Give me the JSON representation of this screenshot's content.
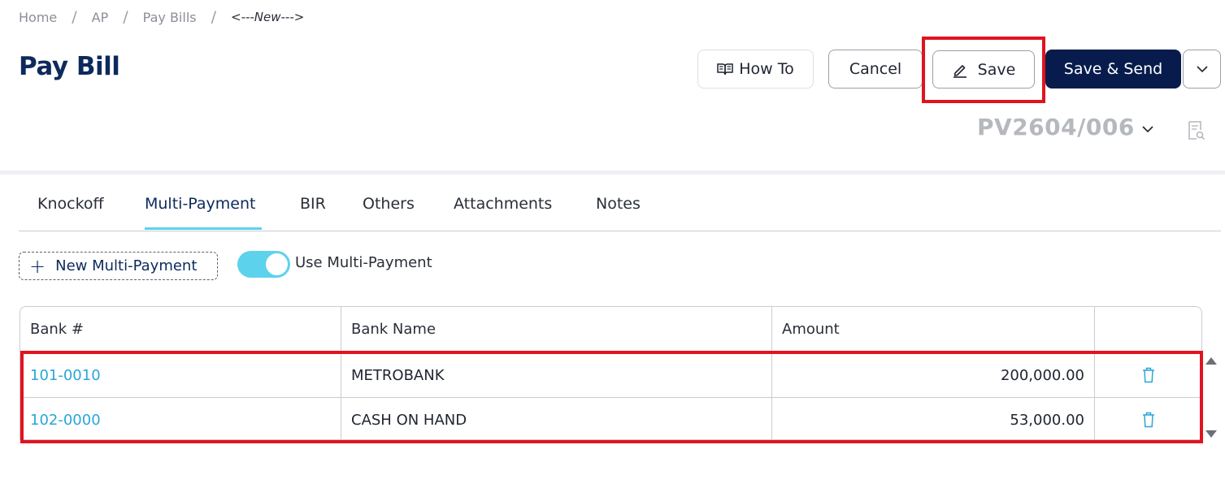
{
  "breadcrumb": {
    "items": [
      "Home",
      "AP",
      "Pay Bills",
      "<---New--->"
    ],
    "separator": "/"
  },
  "page": {
    "title": "Pay Bill"
  },
  "toolbar": {
    "how_to_label": "How To",
    "cancel_label": "Cancel",
    "save_label": "Save",
    "save_send_label": "Save & Send"
  },
  "document": {
    "number": "PV2604/006"
  },
  "tabs": [
    {
      "label": "Knockoff"
    },
    {
      "label": "Multi-Payment",
      "active": true
    },
    {
      "label": "BIR"
    },
    {
      "label": "Others"
    },
    {
      "label": "Attachments"
    },
    {
      "label": "Notes"
    }
  ],
  "multi_payment": {
    "new_button_label": "New Multi-Payment",
    "toggle_label": "Use Multi-Payment",
    "toggle_on": true,
    "columns": [
      "Bank #",
      "Bank Name",
      "Amount"
    ],
    "rows": [
      {
        "bank_no": "101-0010",
        "bank_name": "METROBANK",
        "amount": "200,000.00"
      },
      {
        "bank_no": "102-0000",
        "bank_name": "CASH ON HAND",
        "amount": "53,000.00"
      }
    ]
  },
  "icons": {
    "how_to": "book-icon",
    "save": "pencil-icon",
    "more": "chevron-down-icon",
    "doc_dropdown": "chevron-down-icon",
    "doc_search": "document-search-icon",
    "delete": "trash-icon",
    "add": "plus-icon"
  },
  "colors": {
    "primary": "#071c4d",
    "title": "#0d2a5c",
    "accent": "#5dd2ec",
    "link": "#2aa6d8",
    "highlight": "#e0141f"
  }
}
